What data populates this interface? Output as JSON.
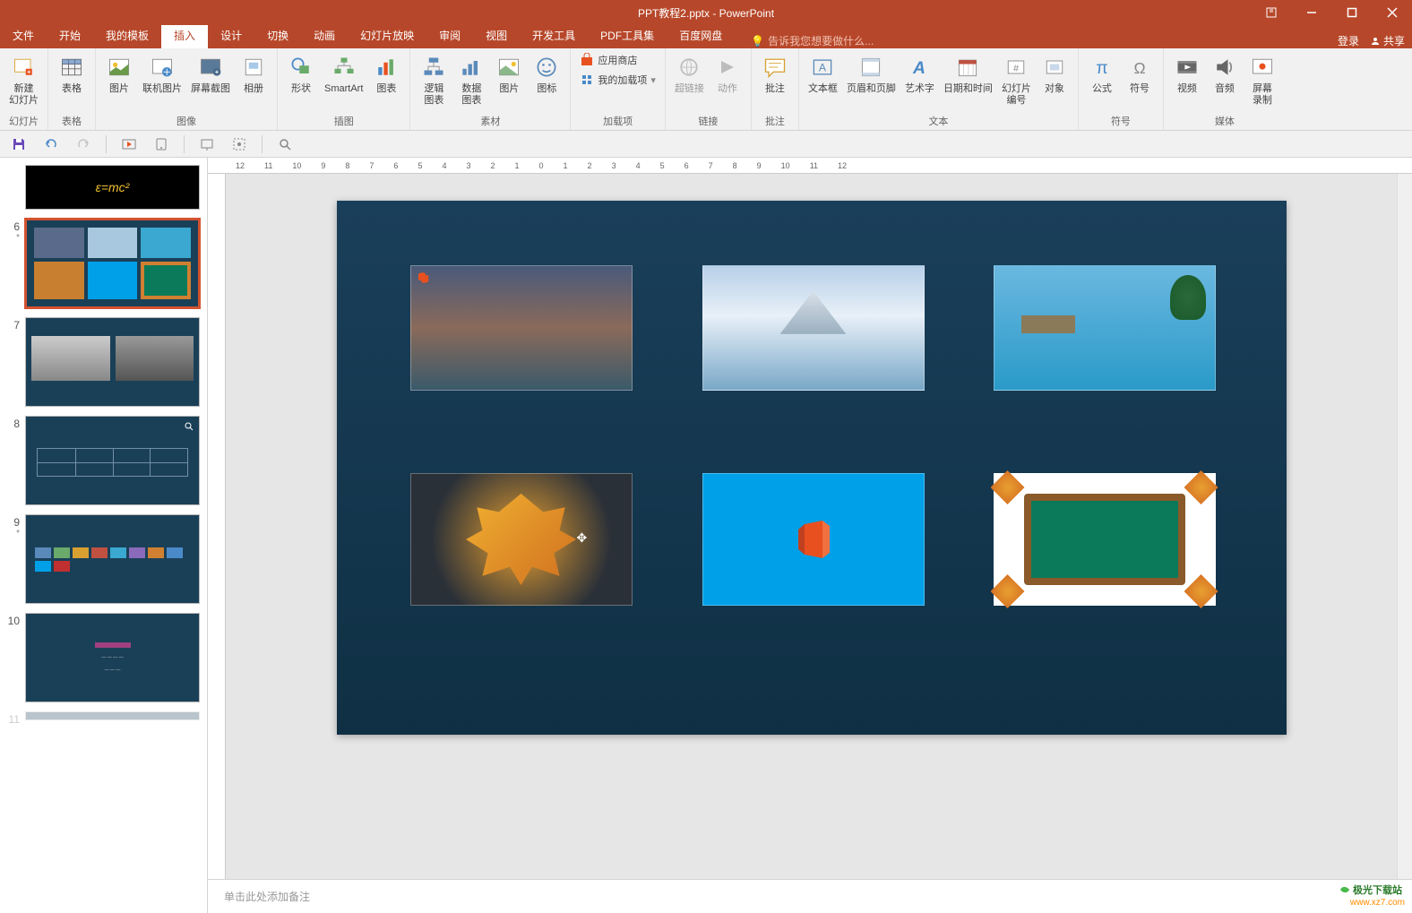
{
  "title": "PPT教程2.pptx - PowerPoint",
  "menutabs": {
    "file": "文件",
    "home": "开始",
    "templates": "我的模板",
    "insert": "插入",
    "design": "设计",
    "transitions": "切换",
    "animations": "动画",
    "slideshow": "幻灯片放映",
    "review": "审阅",
    "view": "视图",
    "developer": "开发工具",
    "pdftools": "PDF工具集",
    "baidu": "百度网盘"
  },
  "tellme_placeholder": "告诉我您想要做什么...",
  "login": "登录",
  "share": "共享",
  "ribbon": {
    "slides": {
      "label": "幻灯片",
      "newslide": "新建\n幻灯片"
    },
    "tables": {
      "label": "表格",
      "table": "表格"
    },
    "images": {
      "label": "图像",
      "picture": "图片",
      "online": "联机图片",
      "screenshot": "屏幕截图",
      "album": "相册"
    },
    "illustrations": {
      "label": "插图",
      "shapes": "形状",
      "smartart": "SmartArt",
      "chart": "图表"
    },
    "material": {
      "label": "素材",
      "editchart": "逻辑\n图表",
      "datachart": "数据\n图表",
      "picture": "图片",
      "icon": "图标"
    },
    "addins": {
      "label": "加载项",
      "store": "应用商店",
      "myaddins": "我的加载项"
    },
    "links": {
      "label": "链接",
      "hyperlink": "超链接",
      "action": "动作"
    },
    "comments": {
      "label": "批注",
      "comment": "批注"
    },
    "text": {
      "label": "文本",
      "textbox": "文本框",
      "headerfooter": "页眉和页脚",
      "wordart": "艺术字",
      "datetime": "日期和时间",
      "slidenum": "幻灯片\n编号",
      "object": "对象"
    },
    "symbols": {
      "label": "符号",
      "equation": "公式",
      "symbol": "符号"
    },
    "media": {
      "label": "媒体",
      "video": "视频",
      "audio": "音频",
      "screenrec": "屏幕\n录制"
    }
  },
  "thumbs": [
    {
      "num": "",
      "star": "",
      "sel": false
    },
    {
      "num": "6",
      "star": "*",
      "sel": true
    },
    {
      "num": "7",
      "star": "",
      "sel": false
    },
    {
      "num": "8",
      "star": "",
      "sel": false
    },
    {
      "num": "9",
      "star": "*",
      "sel": false
    },
    {
      "num": "10",
      "star": "",
      "sel": false
    },
    {
      "num": "11",
      "star": "",
      "sel": false
    }
  ],
  "notes_placeholder": "单击此处添加备注",
  "watermark": {
    "line1": "极光下载站",
    "line2": "www.xz7.com"
  },
  "ruler_marks": [
    "12",
    "11",
    "10",
    "9",
    "8",
    "7",
    "6",
    "5",
    "4",
    "3",
    "2",
    "1",
    "0",
    "1",
    "2",
    "3",
    "4",
    "5",
    "6",
    "7",
    "8",
    "9",
    "10",
    "11",
    "12"
  ]
}
